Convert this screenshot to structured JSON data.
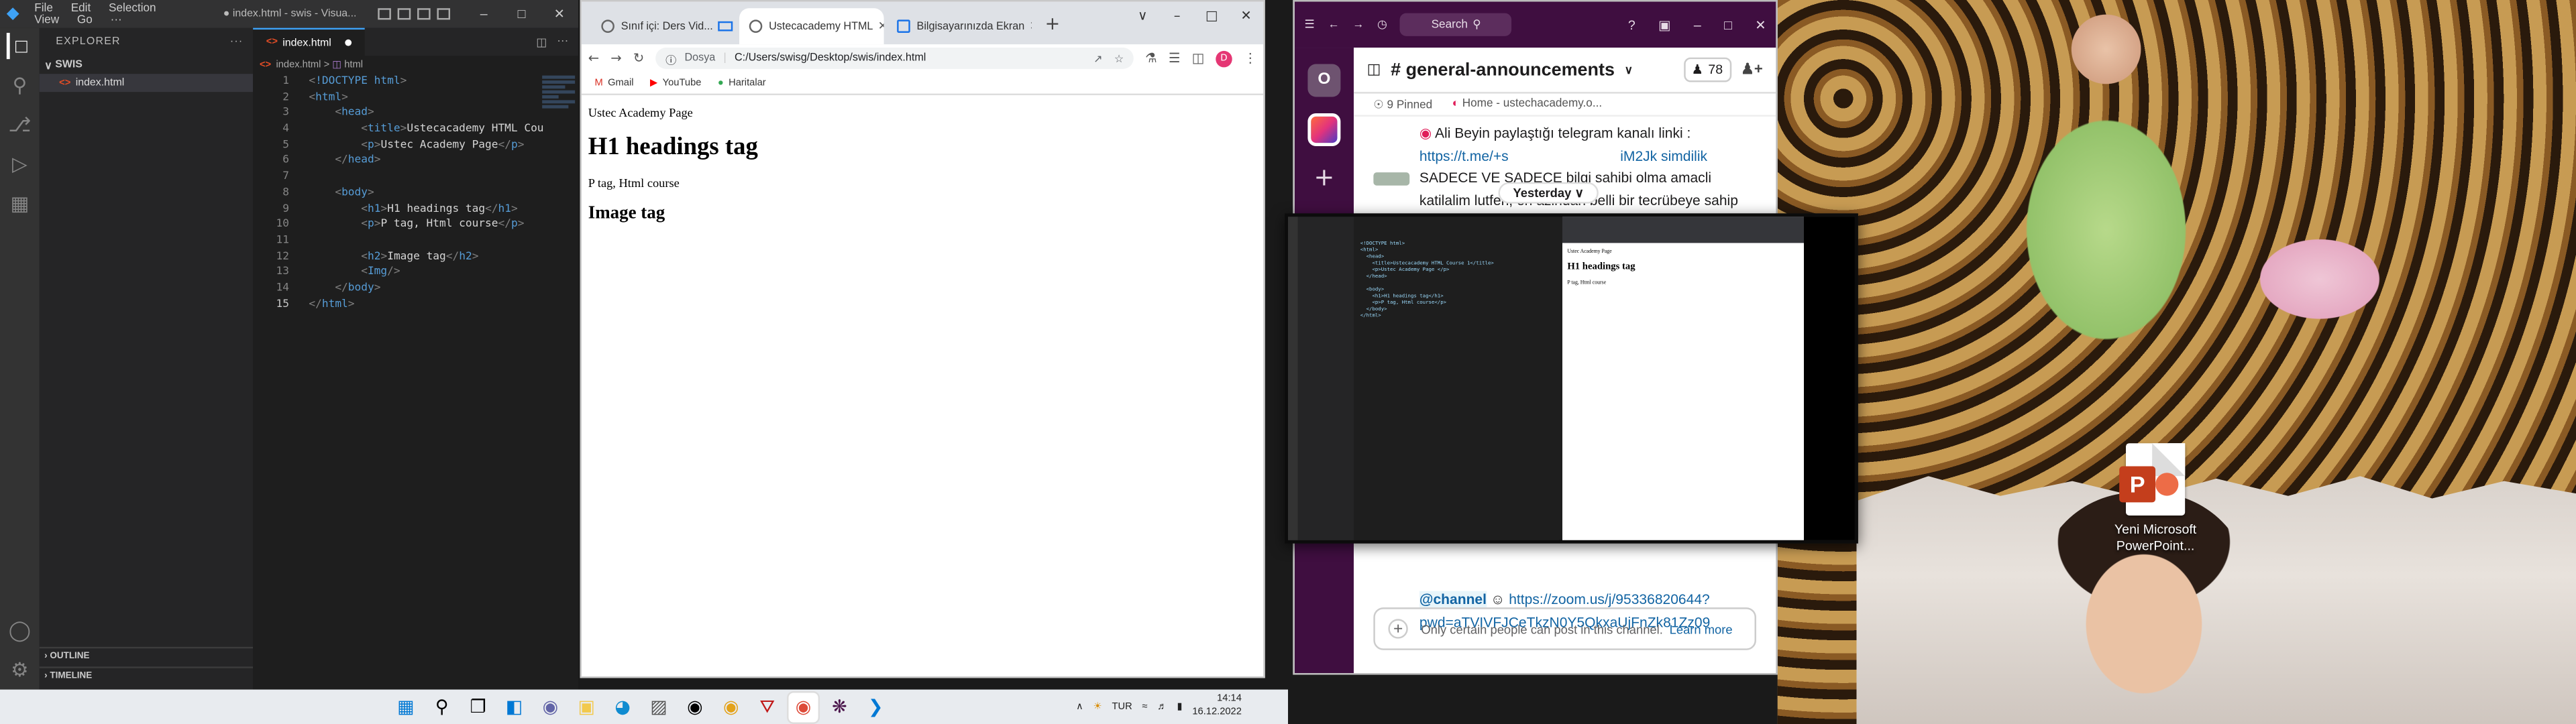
{
  "desktop": {
    "icon_label_line1": "Yeni Microsoft",
    "icon_label_line2": "PowerPoint..."
  },
  "vscode": {
    "menu": [
      "File",
      "Edit",
      "Selection",
      "View",
      "Go",
      "···"
    ],
    "window_title": "● index.html - swis - Visua...",
    "explorer_title": "EXPLORER",
    "folder": "SWIS",
    "file": "index.html",
    "outline": "OUTLINE",
    "timeline": "TIMELINE",
    "tab_label": "index.html",
    "breadcrumb_file": "index.html",
    "breadcrumb_sep": ">",
    "breadcrumb_node": "html",
    "code_lines": [
      "<!DOCTYPE html>",
      "<html>",
      "    <head>",
      "        <title>Ustecacademy HTML Cou",
      "        <p>Ustec Academy Page</p>",
      "    </head>",
      "",
      "    <body>",
      "        <h1>H1 headings tag</h1>",
      "        <p>P tag, Html course</p>",
      "",
      "        <h2>Image tag</h2>",
      "        <Img/>",
      "    </body>",
      "</html>"
    ]
  },
  "chrome": {
    "tabs": [
      {
        "label": "Sınıf içi: Ders Vid..."
      },
      {
        "label": "Ustecacademy HTML"
      },
      {
        "label": "Bilgisayarınızda Ekran"
      }
    ],
    "scheme": "Dosya",
    "url": "C:/Users/swisg/Desktop/swis/index.html",
    "profile_initial": "D",
    "bookmarks": [
      {
        "label": "Gmail"
      },
      {
        "label": "YouTube"
      },
      {
        "label": "Haritalar"
      }
    ],
    "page": {
      "p1": "Ustec Academy Page",
      "h1": "H1 headings tag",
      "p2": "P tag, Html course",
      "h2": "Image tag"
    }
  },
  "slack": {
    "search": "Search",
    "channel": "# general-announcements",
    "members": "78",
    "pinned": "9 Pinned",
    "bookmark": "Home - ustechacademy.o...",
    "msg1_lines": [
      "Ali Beyin paylaştığı telegram kanalı linki :",
      "https://t.me/+s",
      "iM2Jk simdilik",
      "SADECE VE SADECE bilgi sahibi olma amacli",
      "katilalim lutfen, en azindan belli bir tecrübeye sahip"
    ],
    "date_divider": "Yesterday",
    "msg2_mention": "@channel",
    "msg2_link_line1": "https://zoom.us/j/95336820644?",
    "msg2_link_line2": "pwd=aTVIVFJCeTkzN0Y5QkxaUjFnZk81Zz09",
    "compose_text": "Only certain people can post in this channel.",
    "compose_link": "Learn more",
    "workspace_initial": "O"
  },
  "preview": {
    "page_p1": "Ustec Academy Page",
    "page_h1": "H1 headings tag",
    "page_p2": "P tag, Html course"
  },
  "taskbar": {
    "lang": "TUR",
    "time": "14:14",
    "date": "16.12.2022"
  },
  "colors": {
    "vscode_bg": "#1e1e1e",
    "slack_sidebar": "#3f0e40",
    "chrome_tabstrip": "#dee1e6",
    "link": "#1264a3"
  }
}
